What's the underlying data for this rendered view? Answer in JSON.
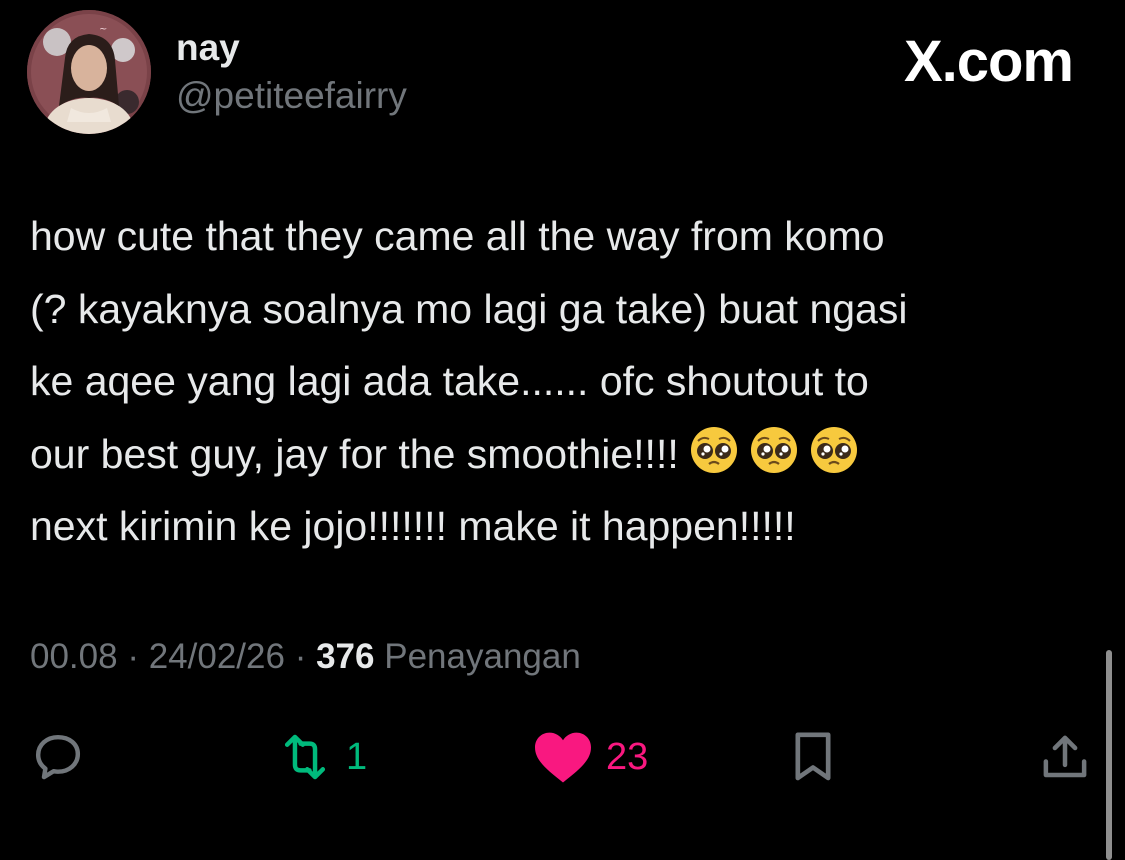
{
  "user": {
    "display_name": "nay",
    "handle": "@petiteefairry"
  },
  "brand": {
    "label": "X.com"
  },
  "tweet": {
    "lines": [
      "how cute that they came all the way from komo",
      "(? kayaknya soalnya mo lagi ga take) buat ngasi",
      "ke aqee yang lagi ada take...... ofc shoutout to",
      "our best guy, jay for the smoothie!!!!",
      "next kirimin ke jojo!!!!!!! make it happen!!!!!"
    ],
    "emojis": [
      "pleading-face-emoji",
      "pleading-face-emoji",
      "pleading-face-emoji"
    ]
  },
  "meta": {
    "time": "00.08",
    "separator": "·",
    "date": "24/02/26",
    "views_count": "376",
    "views_label": "Penayangan"
  },
  "actions": {
    "reply": {
      "icon": "reply-icon",
      "count": ""
    },
    "retweet": {
      "icon": "retweet-icon",
      "count": "1",
      "color": "#00ba7c"
    },
    "like": {
      "icon": "heart-icon",
      "count": "23",
      "color": "#f91880"
    },
    "bookmark": {
      "icon": "bookmark-icon"
    },
    "share": {
      "icon": "share-icon"
    }
  },
  "colors": {
    "background": "#000000",
    "primary_text": "#e7e9ea",
    "secondary_text": "#71767b"
  }
}
